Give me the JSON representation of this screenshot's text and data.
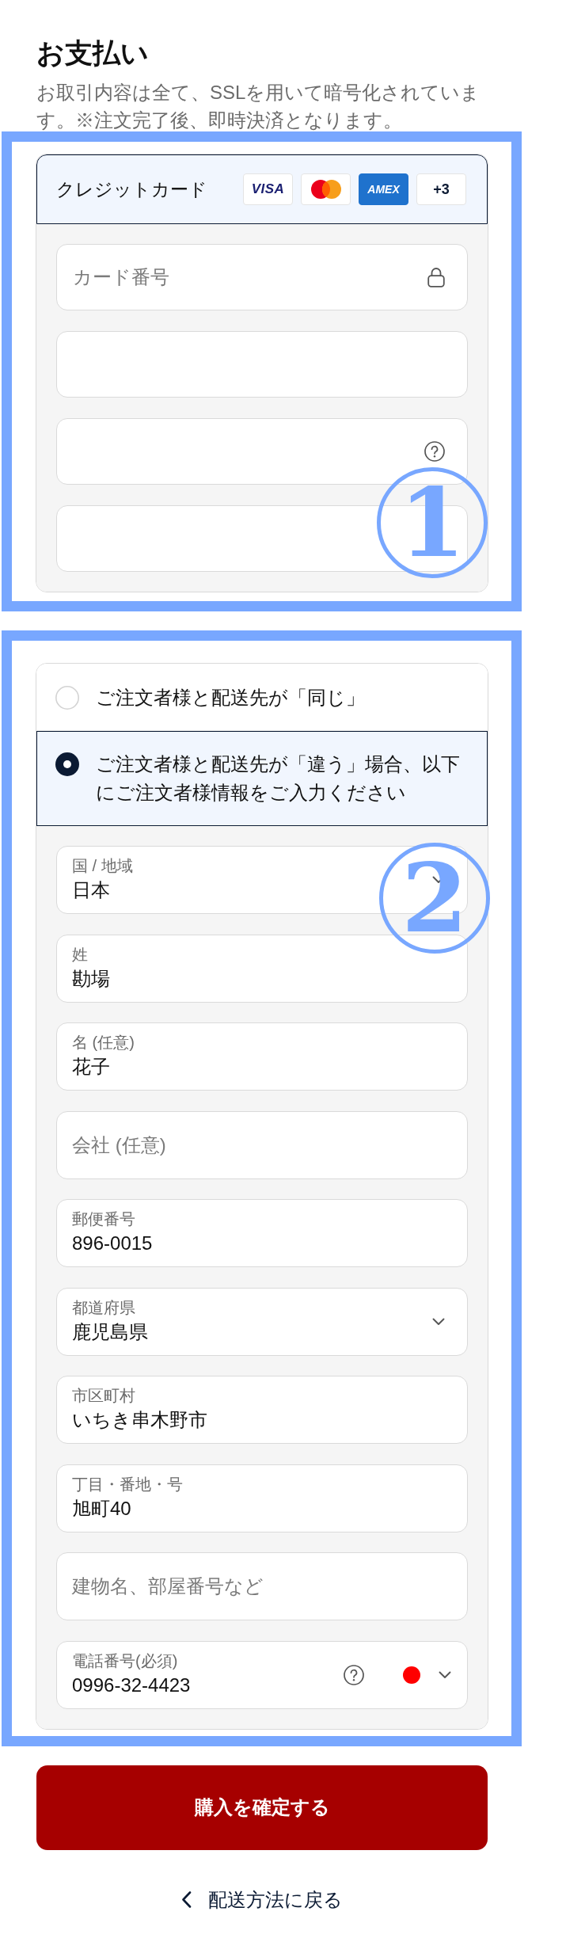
{
  "header": {
    "title": "お支払い",
    "description": "お取引内容は全て、SSLを用いて暗号化されています。※注文完了後、即時決済となります。"
  },
  "payment_section": {
    "marker": "1",
    "payment_method": {
      "label": "クレジットカード",
      "selected": true,
      "brands": [
        {
          "kind": "visa",
          "text": "VISA"
        },
        {
          "kind": "mastercard"
        },
        {
          "kind": "amex",
          "text": "AMEX"
        },
        {
          "kind": "more",
          "text": "+3"
        }
      ]
    },
    "card_fields": [
      {
        "kind": "locked",
        "placeholder": "カード番号"
      },
      {
        "kind": "plain"
      },
      {
        "kind": "help"
      },
      {
        "kind": "plain"
      }
    ]
  },
  "address_section": {
    "marker": "2",
    "shipping_options": [
      {
        "label": "ご注文者様と配送先が「同じ」",
        "selected": false
      },
      {
        "label": "ご注文者様と配送先が「違う」場合、以下にご注文者様情報をご入力ください",
        "selected": true
      }
    ],
    "fields": [
      {
        "kind": "select",
        "label": "国 / 地域",
        "value": "日本"
      },
      {
        "kind": "text",
        "label": "姓",
        "value": "勘場"
      },
      {
        "kind": "text",
        "label": "名 (任意)",
        "value": "花子"
      },
      {
        "kind": "text",
        "placeholder": "会社 (任意)"
      },
      {
        "kind": "text",
        "label": "郵便番号",
        "value": "896-0015"
      },
      {
        "kind": "select",
        "label": "都道府県",
        "value": "鹿児島県"
      },
      {
        "kind": "text",
        "label": "市区町村",
        "value": "いちき串木野市"
      },
      {
        "kind": "text",
        "label": "丁目・番地・号",
        "value": "旭町40"
      },
      {
        "kind": "text",
        "placeholder": "建物名、部屋番号など"
      },
      {
        "kind": "phone",
        "label": "電話番号(必須)",
        "value": "0996-32-4423"
      }
    ]
  },
  "submit_button": {
    "label": "購入を確定する"
  },
  "back_link": {
    "label": "配送方法に戻る"
  }
}
